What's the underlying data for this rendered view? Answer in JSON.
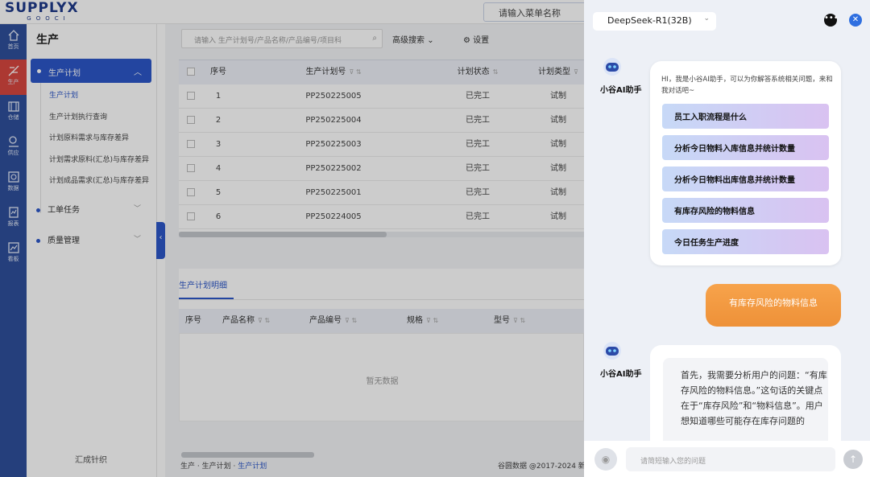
{
  "app": {
    "logo_line1": "SUPPLYX",
    "logo_line2": "GOOCI",
    "menu_search_placeholder": "请输入菜单名称"
  },
  "rail": [
    {
      "label": "首页",
      "icon": "home-icon"
    },
    {
      "label": "生产",
      "icon": "production-icon",
      "active": true
    },
    {
      "label": "仓储",
      "icon": "warehouse-icon"
    },
    {
      "label": "供应",
      "icon": "supply-icon"
    },
    {
      "label": "数据",
      "icon": "data-icon"
    },
    {
      "label": "报表",
      "icon": "report-icon"
    },
    {
      "label": "看板",
      "icon": "dashboard-icon"
    }
  ],
  "sidebar": {
    "title": "生产",
    "group_label": "生产计划",
    "sub_items": [
      {
        "label": "生产计划",
        "active": true
      },
      {
        "label": "生产计划执行查询"
      },
      {
        "label": "计划原料需求与库存差异"
      },
      {
        "label": "计划需求原料(汇总)与库存差异"
      },
      {
        "label": "计划成品需求(汇总)与库存差异"
      }
    ],
    "categories": [
      {
        "label": "工单任务"
      },
      {
        "label": "质量管理"
      }
    ],
    "footer": "汇成针织"
  },
  "main": {
    "search_placeholder": "请输入 生产计划号/产品名称/产品编号/项目科",
    "advanced_search": "高级搜索",
    "settings": "设置",
    "table": {
      "headers": [
        "序号",
        "生产计划号",
        "计划状态",
        "计划类型"
      ],
      "rows": [
        {
          "no": "1",
          "plan": "PP250225005",
          "status": "已完工",
          "type": "试制"
        },
        {
          "no": "2",
          "plan": "PP250225004",
          "status": "已完工",
          "type": "试制"
        },
        {
          "no": "3",
          "plan": "PP250225003",
          "status": "已完工",
          "type": "试制"
        },
        {
          "no": "4",
          "plan": "PP250225002",
          "status": "已完工",
          "type": "试制"
        },
        {
          "no": "5",
          "plan": "PP250225001",
          "status": "已完工",
          "type": "试制"
        },
        {
          "no": "6",
          "plan": "PP250224005",
          "status": "已完工",
          "type": "试制"
        }
      ]
    },
    "detail_tab": "生产计划明细",
    "detail_headers": [
      "序号",
      "产品名称",
      "产品编号",
      "规格",
      "型号"
    ],
    "no_data": "暂无数据",
    "breadcrumb": {
      "a": "生产",
      "b": "生产计划",
      "c": "生产计划"
    },
    "copyright": "谷圆数据 @2017-2024 新"
  },
  "chat": {
    "model": "DeepSeek-R1(32B)",
    "bot_name": "小谷AI助手",
    "greeting": "HI，我是小谷AI助手，可以为你解答系统相关问题，来和我对话吧~",
    "suggestions": [
      "员工入职流程是什么",
      "分析今日物料入库信息并统计数量",
      "分析今日物料出库信息并统计数量",
      "有库存风险的物料信息",
      "今日任务生产进度"
    ],
    "user_message": "有库存风险的物料信息",
    "bot_reply": "首先，我需要分析用户的问题：“有库存风险的物料信息。”这句话的关键点在于“库存风险”和“物料信息”。用户想知道哪些可能存在库存问题的",
    "input_placeholder": "请简短输入您的问题"
  }
}
